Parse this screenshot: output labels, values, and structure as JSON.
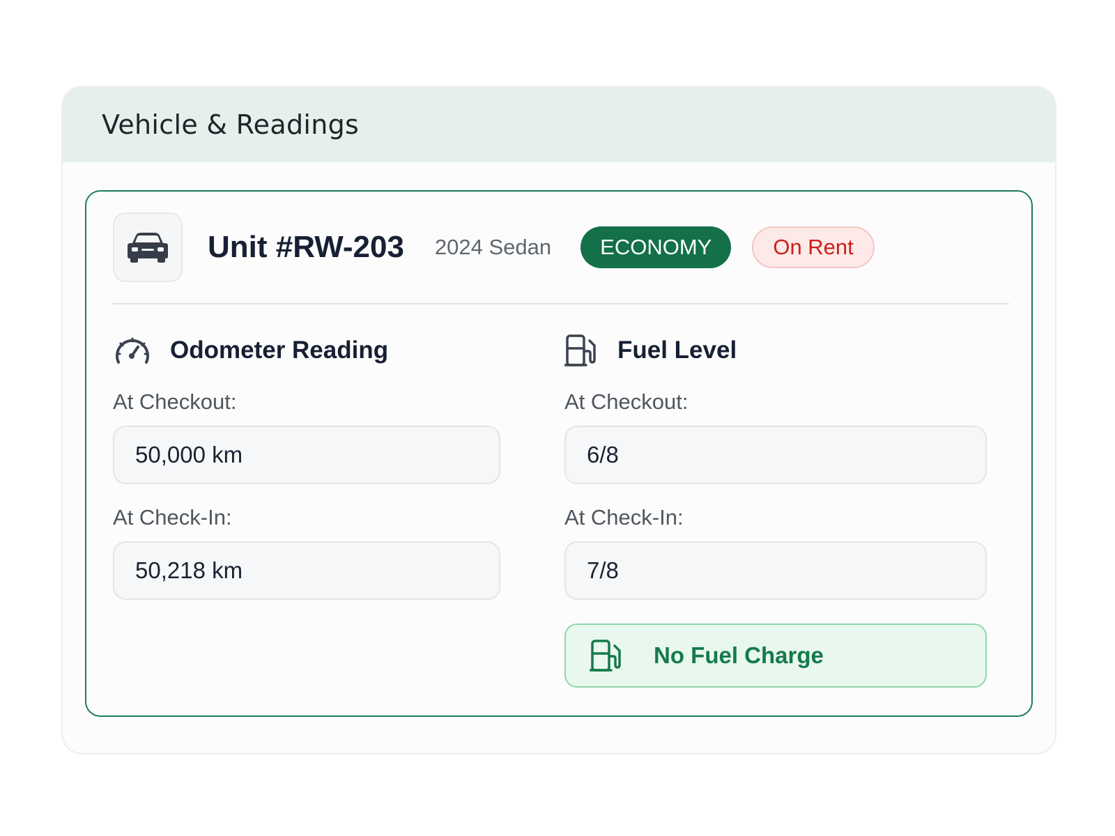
{
  "panel": {
    "title": "Vehicle & Readings"
  },
  "vehicle": {
    "icon": "car-icon",
    "unit": "Unit #RW-203",
    "model": "2024 Sedan",
    "class_badge": "ECONOMY",
    "status_badge": "On Rent",
    "colors": {
      "accent": "#1c7d53",
      "class_badge_bg": "#137048",
      "status_text": "#c8211b",
      "status_bg": "#fde9e8"
    }
  },
  "odometer": {
    "icon": "speedometer-icon",
    "title": "Odometer Reading",
    "checkout_label": "At Checkout:",
    "checkout_value": "50,000 km",
    "checkin_label": "At Check-In:",
    "checkin_value": "50,218 km"
  },
  "fuel": {
    "icon": "fuel-pump-icon",
    "title": "Fuel Level",
    "checkout_label": "At Checkout:",
    "checkout_value": "6/8",
    "checkin_label": "At Check-In:",
    "checkin_value": "7/8",
    "charge_banner": "No Fuel Charge",
    "charge_banner_color": "#157a4a"
  }
}
